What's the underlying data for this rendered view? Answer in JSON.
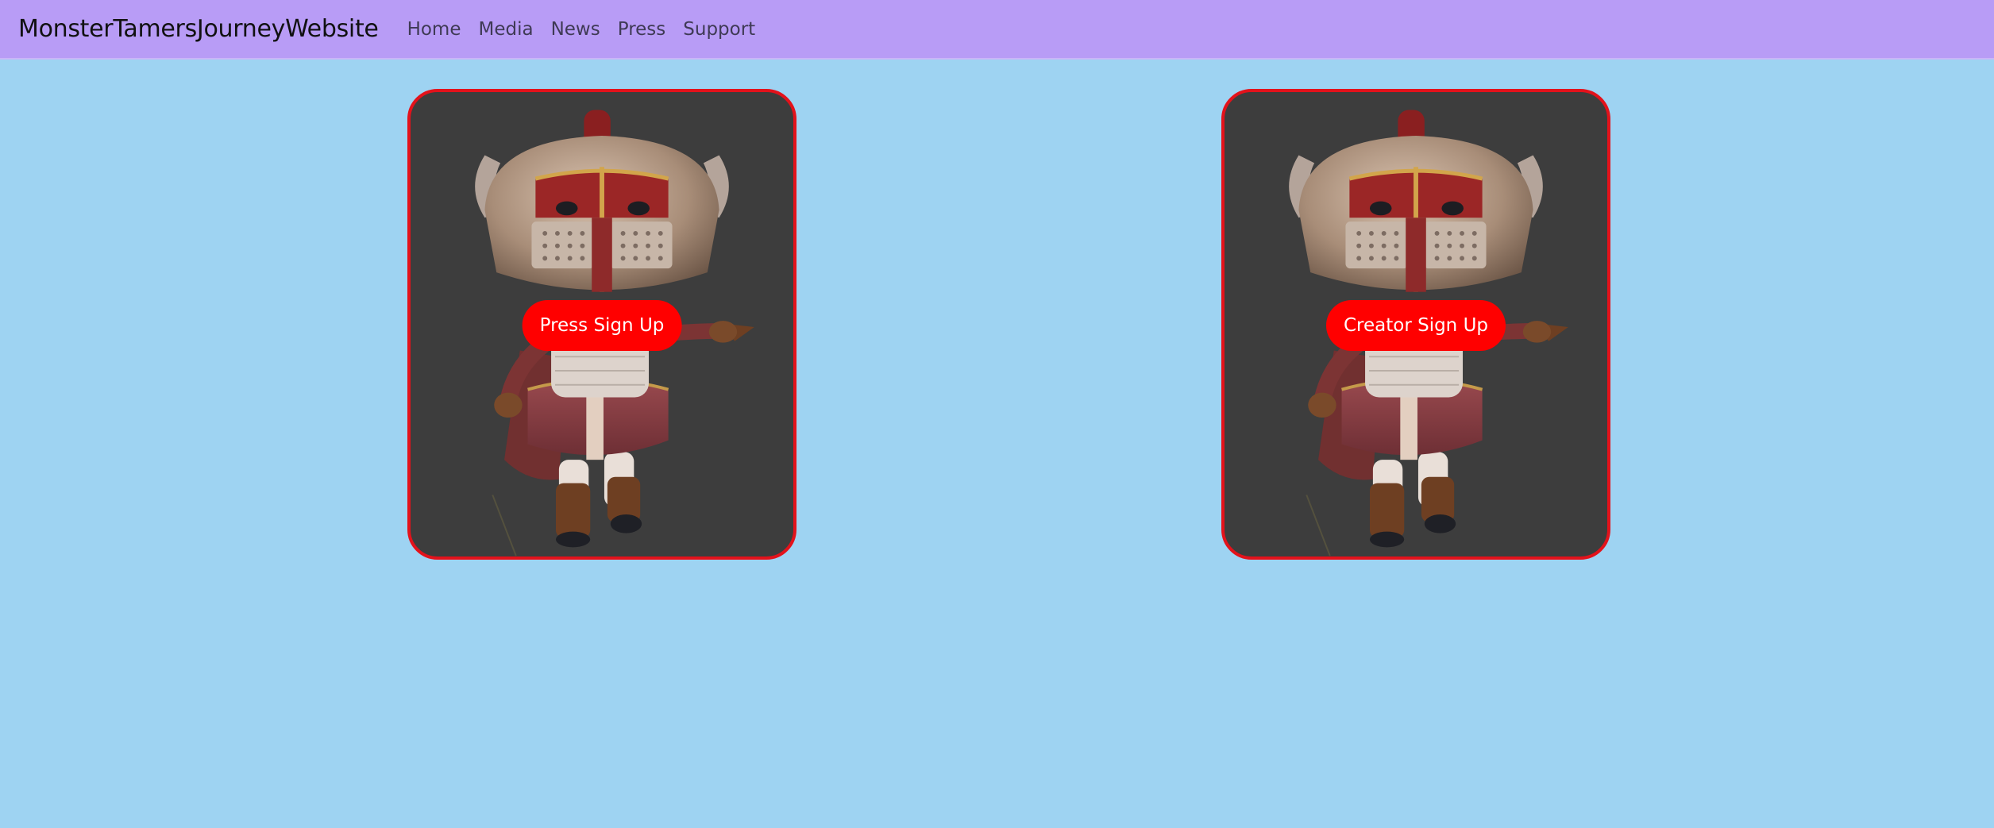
{
  "colors": {
    "page_background": "#9ed3f2",
    "navbar_background": "#b89cf6",
    "card_border": "#e3121b",
    "card_background": "#3d3d3d",
    "button_background": "#ff0000",
    "button_text": "#ffffff"
  },
  "navbar": {
    "brand": "MonsterTamersJourneyWebsite",
    "links": [
      {
        "label": "Home"
      },
      {
        "label": "Media"
      },
      {
        "label": "News"
      },
      {
        "label": "Press"
      },
      {
        "label": "Support"
      }
    ]
  },
  "cards": [
    {
      "image": "armored-knight-character-render",
      "button_label": "Press Sign Up"
    },
    {
      "image": "armored-knight-character-render",
      "button_label": "Creator Sign Up"
    }
  ]
}
